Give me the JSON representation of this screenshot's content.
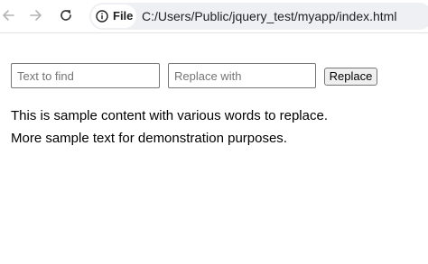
{
  "browser": {
    "nav": {
      "back_icon": "arrow-left-icon",
      "forward_icon": "arrow-right-icon",
      "reload_icon": "reload-icon"
    },
    "omnibox": {
      "scheme_icon": "info-icon",
      "scheme_label": "File",
      "url": "C:/Users/Public/jquery_test/myapp/index.html"
    }
  },
  "form": {
    "find_placeholder": "Text to find",
    "find_value": "",
    "replace_placeholder": "Replace with",
    "replace_value": "",
    "replace_button_label": "Replace"
  },
  "content": {
    "paragraphs": [
      "This is sample content with various words to replace.",
      "More sample text for demonstration purposes."
    ]
  }
}
